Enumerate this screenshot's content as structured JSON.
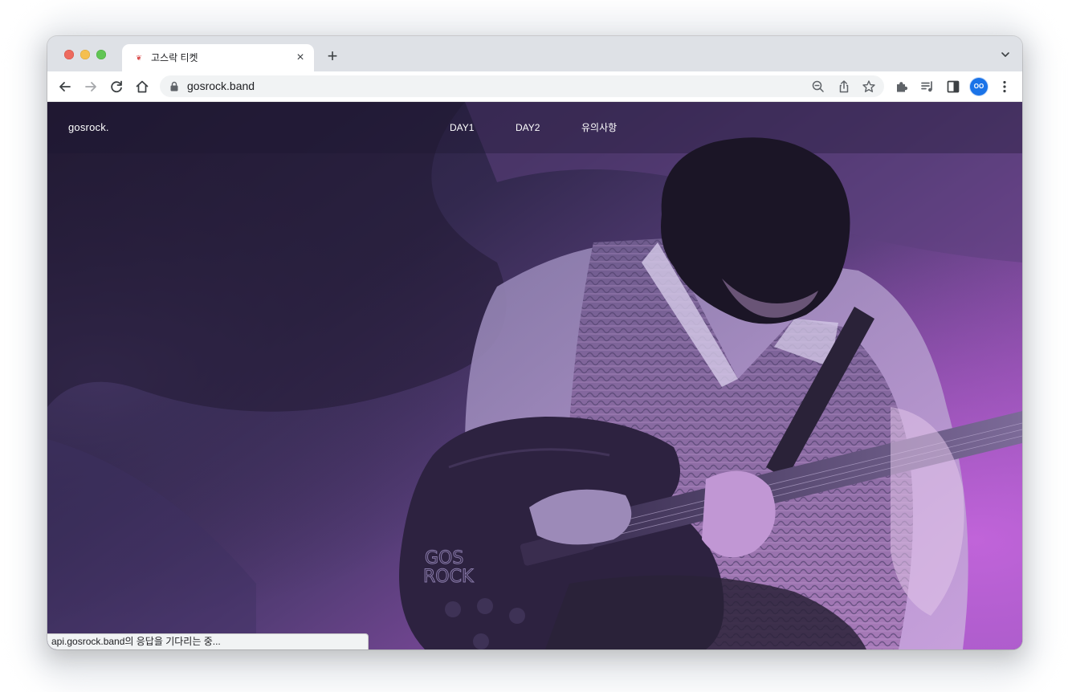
{
  "browser": {
    "tab": {
      "title": "고스락 티켓",
      "favicon": "rose-icon"
    },
    "address": {
      "url": "gosrock.band"
    },
    "avatar": {
      "initials": "OO"
    }
  },
  "site": {
    "logo": "gosrock.",
    "nav": [
      {
        "label": "DAY1"
      },
      {
        "label": "DAY2"
      },
      {
        "label": "유의사항"
      }
    ]
  },
  "status": {
    "text": "api.gosrock.band의 응답을 기다리는 중..."
  },
  "colors": {
    "accent": "#1a73e8",
    "hero_dark": "#2d2344",
    "hero_magenta": "#b25fd0"
  }
}
